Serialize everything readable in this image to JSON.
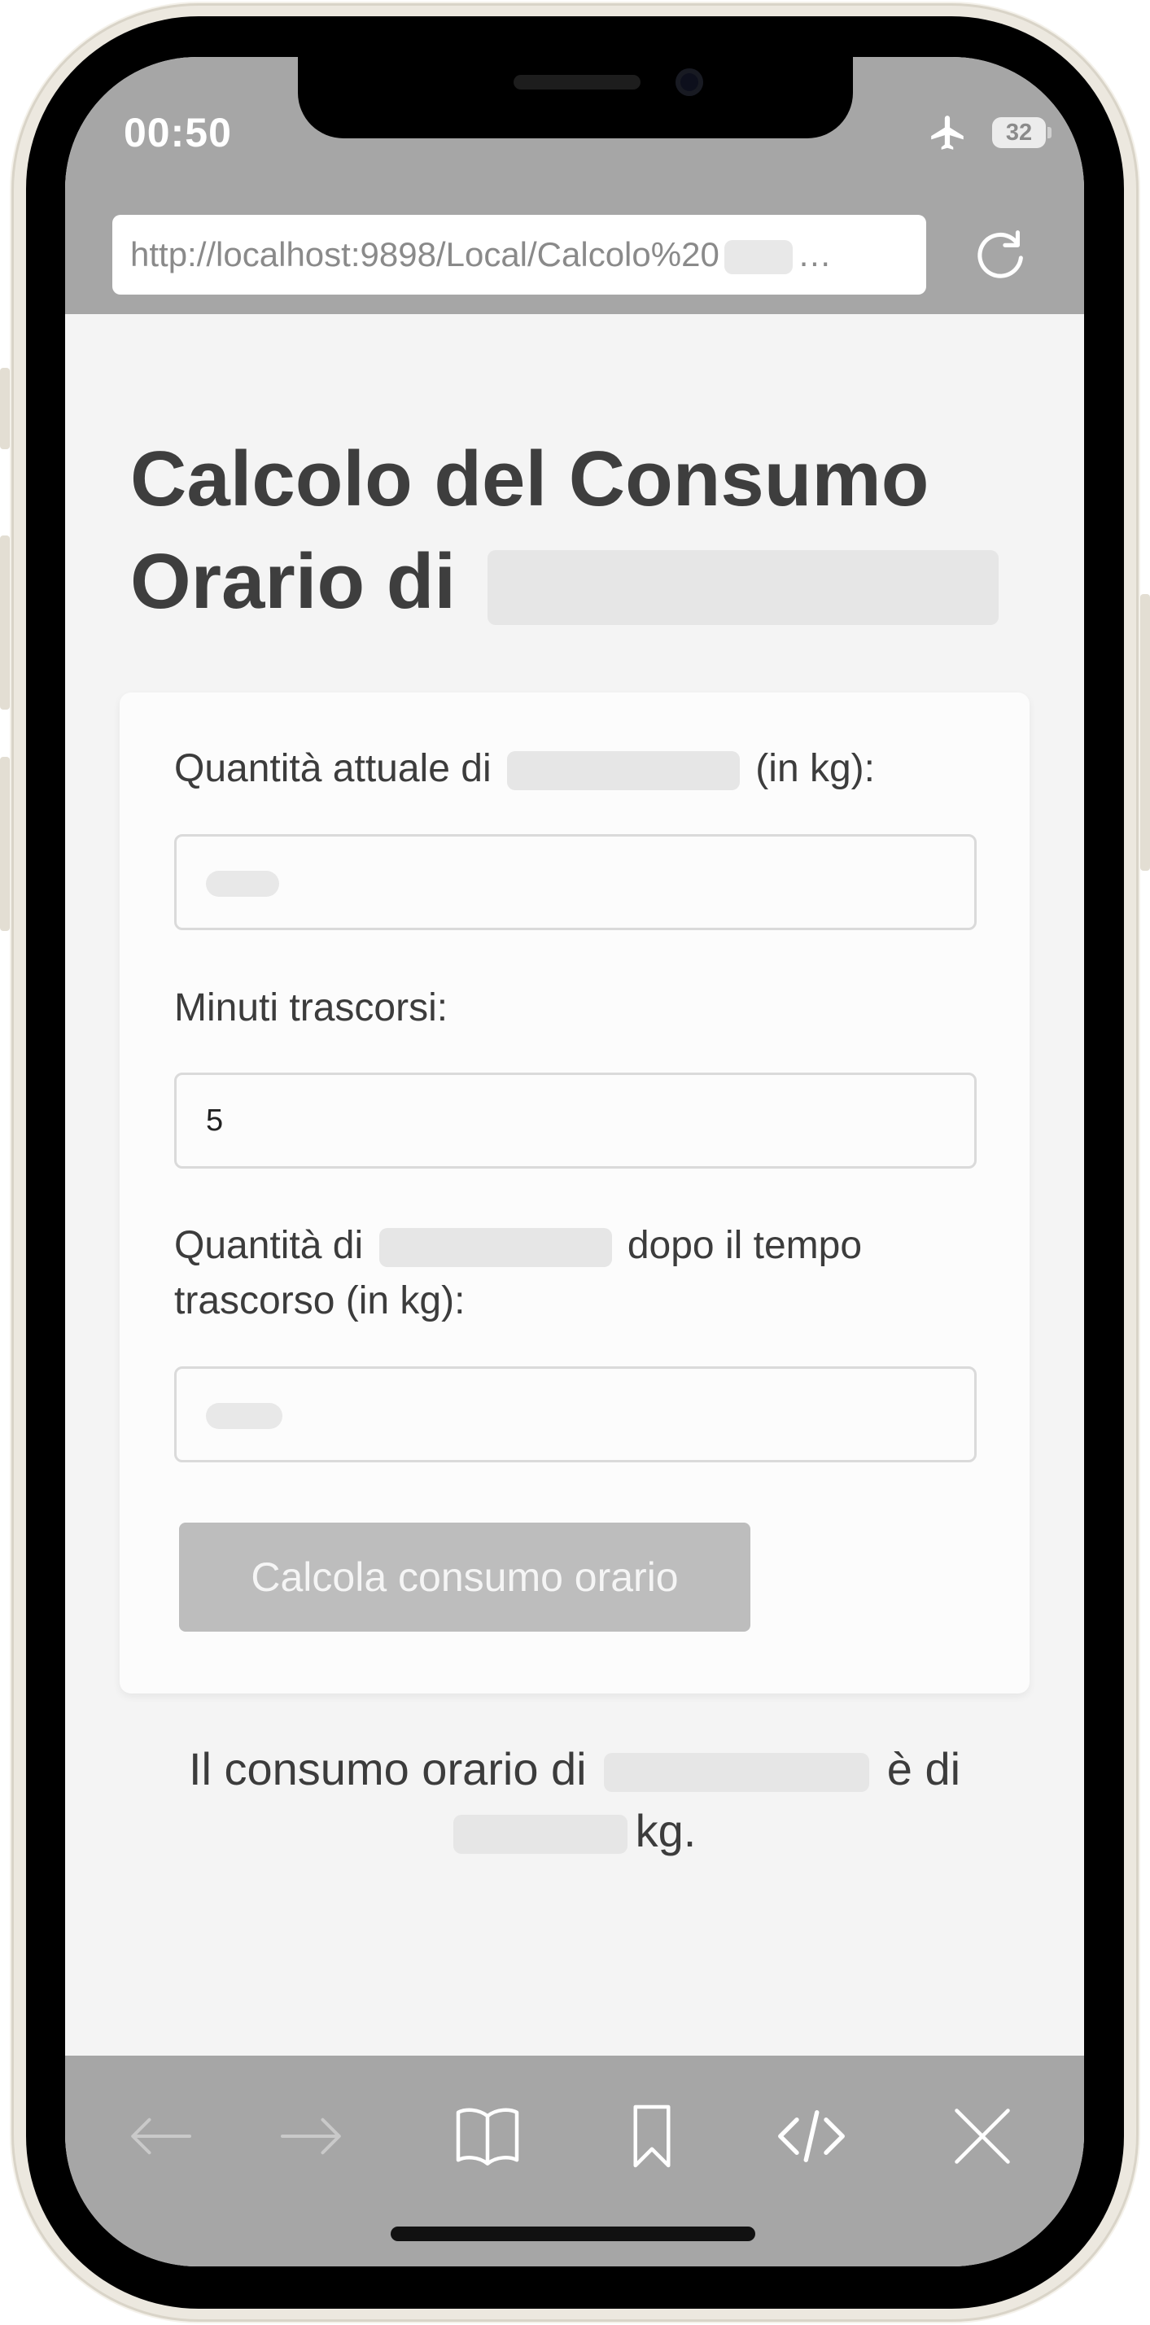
{
  "status_bar": {
    "time": "00:50",
    "battery": "32"
  },
  "browser": {
    "url": "http://localhost:9898/Local/Calcolo%20",
    "url_suffix": "…"
  },
  "page": {
    "title_line1": "Calcolo del Consumo",
    "title_line2": "Orario di",
    "field1_label_a": "Quantità attuale di",
    "field1_label_b": "(in kg):",
    "field2_label": "Minuti trascorsi:",
    "field2_value": "5",
    "field3_label_a": "Quantità di",
    "field3_label_b": "dopo il tempo",
    "field3_label_c": "trascorso (in kg):",
    "button_label": "Calcola consumo orario",
    "result_a": "Il consumo orario di",
    "result_b": "è di",
    "result_c": "kg."
  },
  "colors": {
    "toolbar": "#a6a6a6",
    "page_background": "#f4f4f4",
    "button": "#bdbdbd"
  },
  "icons": {
    "toolbar": [
      "back-arrow-icon",
      "forward-arrow-icon",
      "book-icon",
      "bookmark-icon",
      "code-icon",
      "close-icon"
    ],
    "status": [
      "airplane-icon",
      "battery-icon"
    ],
    "browser": [
      "reload-icon"
    ]
  }
}
